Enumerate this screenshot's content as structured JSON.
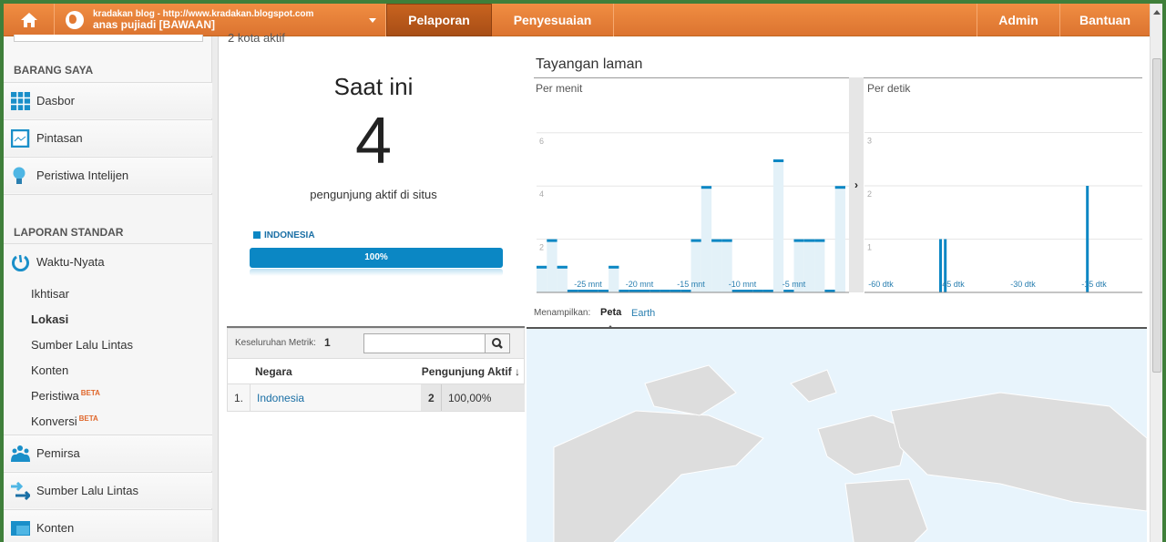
{
  "topbar": {
    "account_line1": "kradakan blog - http://www.kradakan.blogspot.com",
    "account_line2": "anas pujiadi [BAWAAN]",
    "tabs": [
      "Pelaporan",
      "Penyesuaian"
    ],
    "admin": "Admin",
    "help": "Bantuan"
  },
  "sidebar": {
    "section1": "BARANG SAYA",
    "items1": [
      "Dasbor",
      "Pintasan",
      "Peristiwa Intelijen"
    ],
    "section2": "LAPORAN STANDAR",
    "realtime": "Waktu-Nyata",
    "subitems": [
      "Ikhtisar",
      "Lokasi",
      "Sumber Lalu Lintas",
      "Konten",
      "Peristiwa",
      "Konversi"
    ],
    "beta": "BETA",
    "items2": [
      "Pemirsa",
      "Sumber Lalu Lintas",
      "Konten"
    ]
  },
  "summary": {
    "cut_text": "2 kota aktif",
    "title": "Saat ini",
    "count": "4",
    "subtitle": "pengunjung aktif di situs",
    "legend": "INDONESIA",
    "bar_label": "100%",
    "bar_percent": 100
  },
  "table": {
    "metric_label": "Keseluruhan Metrik:",
    "metric_value": "1",
    "search_value": "",
    "col1": "Negara",
    "col2": "Pengunjung Aktif",
    "rows": [
      {
        "rank": "1.",
        "country": "Indonesia",
        "count": "2",
        "pct": "100,00%"
      }
    ]
  },
  "pageviews": {
    "title": "Tayangan laman",
    "per_minute_label": "Per menit",
    "per_second_label": "Per detik",
    "view_label": "Menampilkan:",
    "view_options": [
      "Peta",
      "Earth"
    ]
  },
  "chart_data": [
    {
      "type": "bar",
      "title": "Per menit",
      "yticks": [
        "2",
        "4",
        "6"
      ],
      "ylim": [
        0,
        7
      ],
      "xticks": [
        "-25 mnt",
        "-20 mnt",
        "-15 mnt",
        "-10 mnt",
        "-5 mnt"
      ],
      "values": [
        1,
        2,
        1,
        0,
        0,
        0,
        0,
        1,
        0,
        0,
        0,
        0,
        0,
        0,
        0,
        2,
        4,
        2,
        2,
        0,
        0,
        0,
        0,
        5,
        0,
        2,
        2,
        2,
        0,
        4
      ]
    },
    {
      "type": "bar",
      "title": "Per detik",
      "yticks": [
        "1",
        "2",
        "3"
      ],
      "ylim": [
        0,
        3.5
      ],
      "xticks": [
        "-60 dtk",
        "-45 dtk",
        "-30 dtk",
        "-15 dtk"
      ],
      "points": [
        {
          "sec": -45,
          "value": 1
        },
        {
          "sec": -44,
          "value": 1
        },
        {
          "sec": -14,
          "value": 2
        }
      ]
    }
  ],
  "colors": {
    "accent": "#0b87c4",
    "orange": "#e57d35"
  }
}
